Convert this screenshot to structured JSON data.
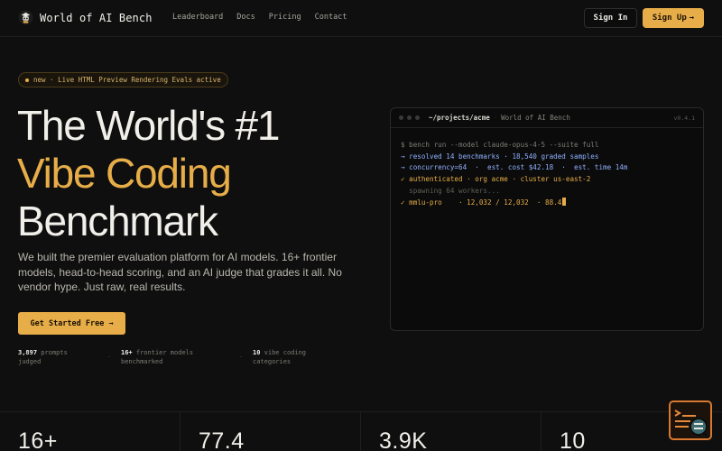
{
  "app": {
    "title": "World of AI Bench"
  },
  "nav": {
    "links": [
      "Leaderboard",
      "Docs",
      "Pricing",
      "Contact"
    ],
    "sign_in": "Sign In",
    "sign_up": "Sign Up",
    "sign_up_arrow": "→"
  },
  "hero": {
    "badge": "new · Live HTML Preview Rendering Evals active",
    "title_line1": "The World's #1",
    "title_line2": "Vibe Coding",
    "title_line3": "Benchmark",
    "lead": "We built the premier evaluation platform for AI models. 16+ frontier models, head-to-head scoring, and an AI judge that grades it all. No vendor hype. Just raw, real results.",
    "cta": "Get Started Free",
    "cta_arrow": "→",
    "stats": [
      {
        "value": "3,897",
        "label_a": "prompts",
        "label_b": "judged"
      },
      {
        "value": "16+",
        "label_a": "frontier models",
        "label_b": "benchmarked"
      },
      {
        "value": "10",
        "label_a": "vibe coding",
        "label_b": "categories"
      }
    ],
    "stat_separator": "·"
  },
  "terminal": {
    "path": "~/projects/acme",
    "separator": "·",
    "title": "World of AI Bench",
    "version": "v0.4.1",
    "lines": [
      "$ bench run --model claude-opus-4-5 --suite full",
      "→ resolved 14 benchmarks · 18,540 graded samples",
      "→ concurrency=64  ·  est. cost $42.18  ·  est. time 14m",
      "✓ authenticated · org acme · cluster us-east-2",
      "  spawning 64 workers...",
      "✓ mmlu-pro    · 12,032 / 12,032  · 88.4"
    ]
  },
  "bottom_stats": [
    "16+",
    "77.4",
    "3.9K",
    "10"
  ],
  "colors": {
    "accent": "#e7ad48",
    "background": "#0f0f0f",
    "info": "#8fb1ff"
  },
  "icons": {
    "logo": "robot-logo-icon",
    "widget": "terminal-search-icon"
  }
}
